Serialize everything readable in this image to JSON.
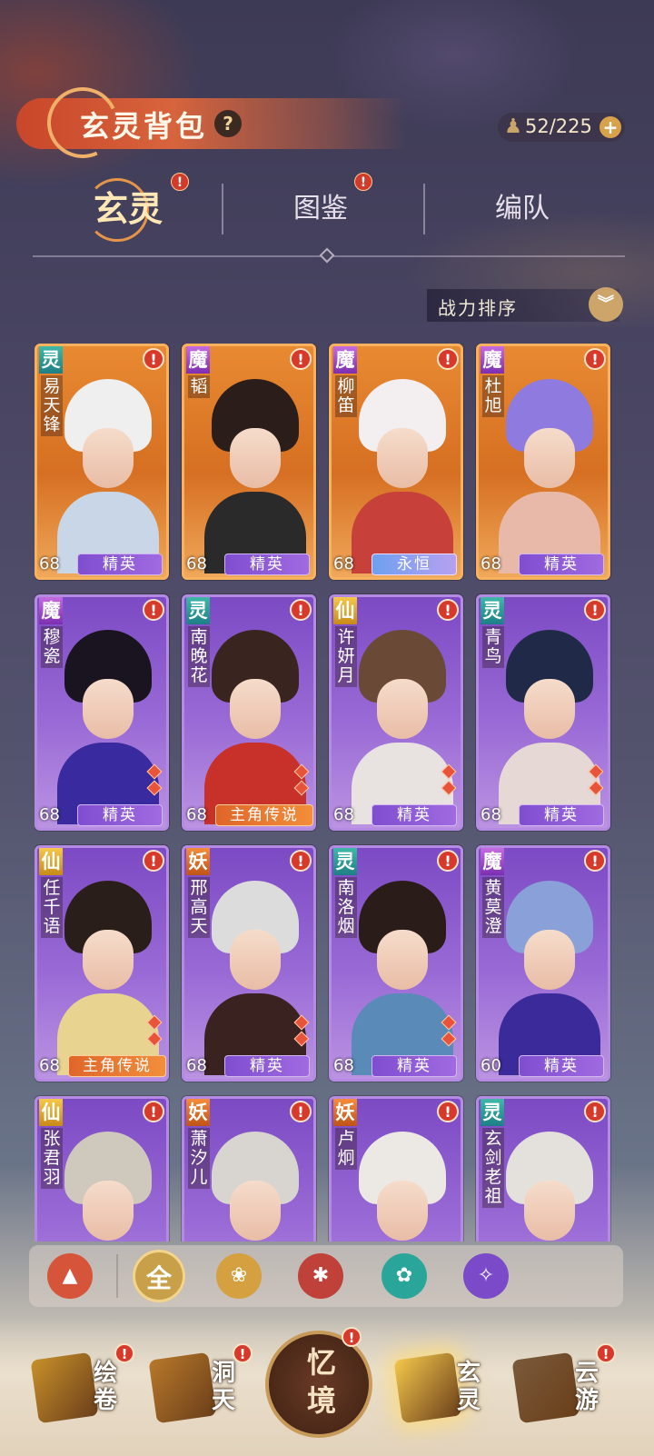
{
  "header": {
    "title": "玄灵背包",
    "help_icon": "?",
    "capacity": "52/225",
    "capacity_plus": "+"
  },
  "tabs": [
    {
      "label": "玄灵",
      "active": true,
      "badge": "!"
    },
    {
      "label": "图鉴",
      "active": false,
      "badge": "!"
    },
    {
      "label": "编队",
      "active": false,
      "badge": ""
    }
  ],
  "sort": {
    "label": "战力排序",
    "icon": "chevron-down-icon"
  },
  "cards": [
    {
      "faction": "灵",
      "name": "易天锋",
      "level": "68",
      "rank": "精英",
      "style": "orange",
      "rank_style": "elite",
      "alert": "!",
      "gems": 0
    },
    {
      "faction": "魔",
      "name": "韬",
      "level": "68",
      "rank": "精英",
      "style": "orange",
      "rank_style": "elite",
      "alert": "!",
      "gems": 0
    },
    {
      "faction": "魔",
      "name": "柳笛",
      "level": "68",
      "rank": "永恒",
      "style": "orange",
      "rank_style": "eternal",
      "alert": "!",
      "gems": 0
    },
    {
      "faction": "魔",
      "name": "杜旭",
      "level": "68",
      "rank": "精英",
      "style": "orange",
      "rank_style": "elite",
      "alert": "!",
      "gems": 0
    },
    {
      "faction": "魔",
      "name": "穆瓷",
      "level": "68",
      "rank": "精英",
      "style": "purple",
      "rank_style": "elite",
      "alert": "!",
      "gems": 2
    },
    {
      "faction": "灵",
      "name": "南晚花",
      "level": "68",
      "rank": "主角传说",
      "style": "purple",
      "rank_style": "legend",
      "alert": "!",
      "gems": 2
    },
    {
      "faction": "仙",
      "name": "许妍月",
      "level": "68",
      "rank": "精英",
      "style": "purple",
      "rank_style": "elite",
      "alert": "!",
      "gems": 2
    },
    {
      "faction": "灵",
      "name": "青鸟",
      "level": "68",
      "rank": "精英",
      "style": "purple",
      "rank_style": "elite",
      "alert": "!",
      "gems": 2
    },
    {
      "faction": "仙",
      "name": "任千语",
      "level": "68",
      "rank": "主角传说",
      "style": "purple",
      "rank_style": "legend",
      "alert": "!",
      "gems": 2
    },
    {
      "faction": "妖",
      "name": "邢高天",
      "level": "68",
      "rank": "精英",
      "style": "purple",
      "rank_style": "elite",
      "alert": "!",
      "gems": 2
    },
    {
      "faction": "灵",
      "name": "南洛烟",
      "level": "68",
      "rank": "精英",
      "style": "purple",
      "rank_style": "elite",
      "alert": "!",
      "gems": 2
    },
    {
      "faction": "魔",
      "name": "黄莫澄",
      "level": "60",
      "rank": "精英",
      "style": "purple",
      "rank_style": "elite",
      "alert": "!",
      "gems": 0
    },
    {
      "faction": "仙",
      "name": "张君羽",
      "level": "",
      "rank": "",
      "style": "purple",
      "rank_style": "elite",
      "alert": "!",
      "gems": 0
    },
    {
      "faction": "妖",
      "name": "萧汐儿",
      "level": "",
      "rank": "",
      "style": "purple",
      "rank_style": "elite",
      "alert": "!",
      "gems": 0
    },
    {
      "faction": "妖",
      "name": "卢炯",
      "level": "",
      "rank": "",
      "style": "purple",
      "rank_style": "elite",
      "alert": "!",
      "gems": 0
    },
    {
      "faction": "灵",
      "name": "玄剑老祖",
      "level": "",
      "rank": "",
      "style": "purple",
      "rank_style": "elite",
      "alert": "!",
      "gems": 0
    }
  ],
  "filters": [
    {
      "label": "▲",
      "icon": "diamond-filter-icon",
      "color": "#d6553a"
    },
    {
      "label": "全",
      "icon": "all-filter-icon",
      "color": "#c9a04a"
    },
    {
      "label": "❀",
      "icon": "lotus-filter-icon",
      "color": "#d4a040"
    },
    {
      "label": "✱",
      "icon": "demon-filter-icon",
      "color": "#c0403a"
    },
    {
      "label": "✿",
      "icon": "spirit-filter-icon",
      "color": "#2aa59a"
    },
    {
      "label": "✧",
      "icon": "magic-filter-icon",
      "color": "#7a4ac8"
    }
  ],
  "nav": [
    {
      "label": "绘卷",
      "icon": "scroll-icon",
      "badge": "!"
    },
    {
      "label": "洞天",
      "icon": "lotus-icon",
      "badge": "!"
    },
    {
      "label": "忆境",
      "icon": "memory-icon",
      "badge": "!"
    },
    {
      "label": "玄灵",
      "icon": "spirit-icon",
      "badge": ""
    },
    {
      "label": "云游",
      "icon": "travel-icon",
      "badge": "!"
    }
  ],
  "colors": {
    "accent_red": "#d7392b",
    "elite_purple": "#8a5bd8",
    "legend_orange": "#e87230",
    "gold": "#cda56b"
  }
}
